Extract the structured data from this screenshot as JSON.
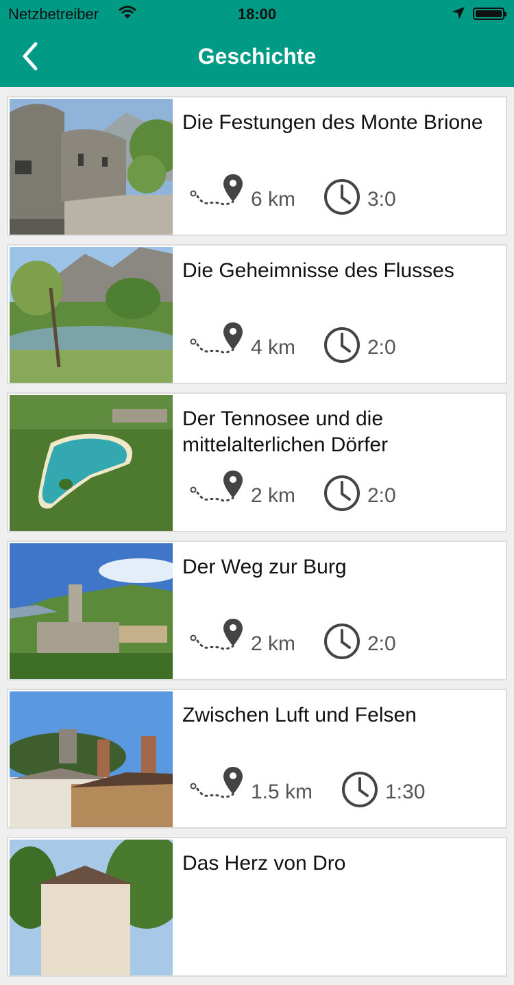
{
  "status_bar": {
    "carrier": "Netzbetreiber",
    "time": "18:00"
  },
  "header": {
    "title": "Geschichte",
    "back_icon": "chevron-left-icon"
  },
  "colors": {
    "accent": "#009a85",
    "meta_text": "#555555"
  },
  "routes": [
    {
      "title": "Die Festungen des Monte Brione",
      "distance": "6 km",
      "duration": "3:0"
    },
    {
      "title": "Die Geheimnisse des Flusses",
      "distance": "4 km",
      "duration": "2:0"
    },
    {
      "title": "Der Tennosee und die mittelalterlichen Dörfer",
      "distance": "2 km",
      "duration": "2:0"
    },
    {
      "title": "Der Weg zur Burg",
      "distance": "2 km",
      "duration": "2:0"
    },
    {
      "title": "Zwischen Luft und Felsen",
      "distance": "1.5 km",
      "duration": "1:30"
    },
    {
      "title": "Das Herz von Dro",
      "distance": "",
      "duration": ""
    }
  ]
}
